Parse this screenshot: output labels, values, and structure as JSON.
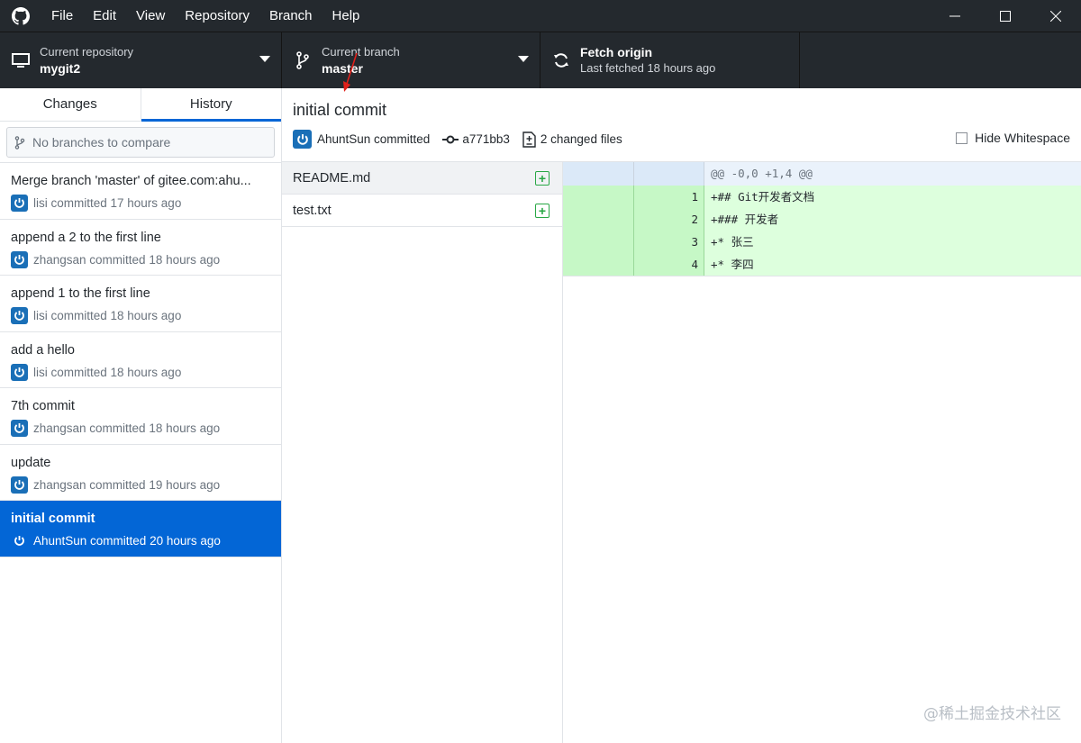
{
  "menu": [
    "File",
    "Edit",
    "View",
    "Repository",
    "Branch",
    "Help"
  ],
  "toolbar": {
    "repo_label": "Current repository",
    "repo_value": "mygit2",
    "branch_label": "Current branch",
    "branch_value": "master",
    "fetch_label": "Fetch origin",
    "fetch_value": "Last fetched 18 hours ago"
  },
  "tabs": {
    "changes": "Changes",
    "history": "History"
  },
  "compare_placeholder": "No branches to compare",
  "commits": [
    {
      "title": "Merge branch 'master' of gitee.com:ahu...",
      "meta": "lisi committed 17 hours ago"
    },
    {
      "title": "append a 2 to the first line",
      "meta": "zhangsan committed 18 hours ago"
    },
    {
      "title": "append 1 to the first line",
      "meta": "lisi committed 18 hours ago"
    },
    {
      "title": "add a hello",
      "meta": "lisi committed 18 hours ago"
    },
    {
      "title": "7th commit",
      "meta": "zhangsan committed 18 hours ago"
    },
    {
      "title": "update",
      "meta": "zhangsan committed 19 hours ago"
    },
    {
      "title": "initial commit",
      "meta": "AhuntSun committed 20 hours ago"
    }
  ],
  "commit_detail": {
    "title": "initial commit",
    "author": "AhuntSun committed",
    "sha": "a771bb3",
    "changed_files": "2 changed files",
    "hide_whitespace": "Hide Whitespace"
  },
  "files": [
    {
      "name": "README.md"
    },
    {
      "name": "test.txt"
    }
  ],
  "diff": {
    "hunk": "@@ -0,0 +1,4 @@",
    "lines": [
      {
        "num": "1",
        "text": "+## Git开发者文档"
      },
      {
        "num": "2",
        "text": "+### 开发者"
      },
      {
        "num": "3",
        "text": "+* 张三"
      },
      {
        "num": "4",
        "text": "+* 李四"
      }
    ]
  },
  "watermark": "@稀土掘金技术社区",
  "colors": {
    "accent": "#0366d6",
    "toolbar": "#24292e",
    "added": "#ddffdd"
  }
}
